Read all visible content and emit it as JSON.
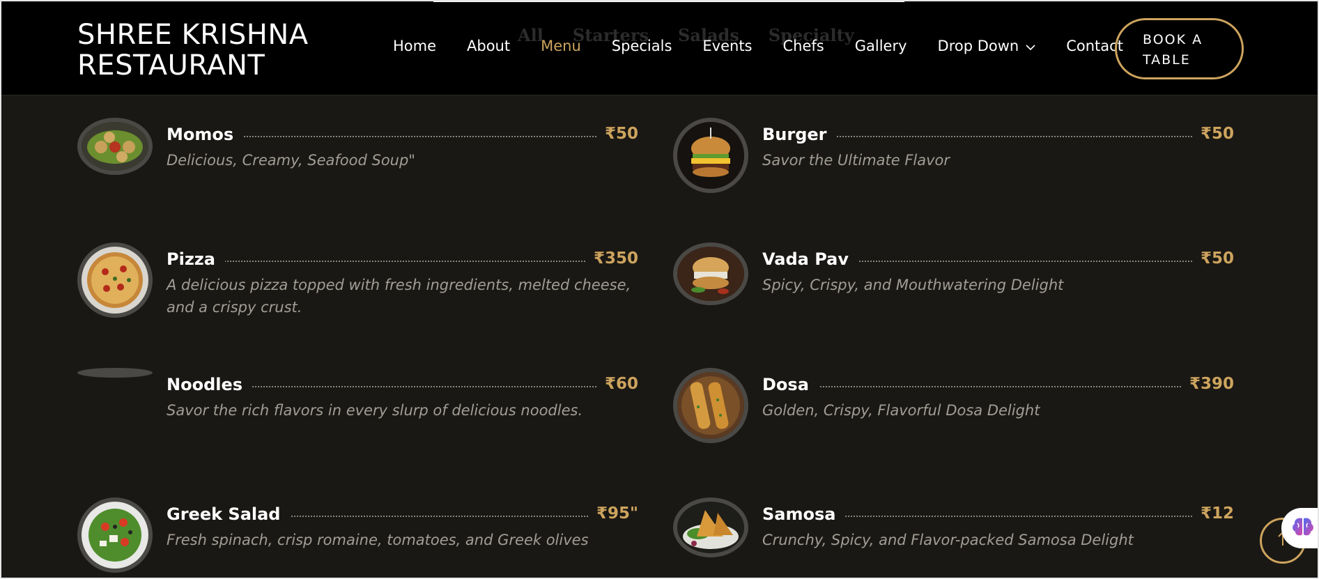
{
  "header": {
    "logo": "SHREE KRISHNA RESTAURANT",
    "logo_line1": "SHREE KRISHNA",
    "logo_line2": "RESTAURANT",
    "nav": [
      {
        "label": "Home"
      },
      {
        "label": "About"
      },
      {
        "label": "Menu",
        "active": true
      },
      {
        "label": "Specials"
      },
      {
        "label": "Events"
      },
      {
        "label": "Chefs"
      },
      {
        "label": "Gallery"
      },
      {
        "label": "Drop Down"
      },
      {
        "label": "Contact"
      }
    ],
    "book_button_line1": "BOOK A",
    "book_button_line2": "TABLE"
  },
  "menu_filters": [
    "All",
    "Starters",
    "Salads",
    "Specialty"
  ],
  "menu_items": [
    {
      "name": "Momos",
      "price": "₹50",
      "description": "Delicious, Creamy, Seafood Soup\""
    },
    {
      "name": "Burger",
      "price": "₹50",
      "description": "Savor the Ultimate Flavor"
    },
    {
      "name": "Pizza",
      "price": "₹350",
      "description": "A delicious pizza topped with fresh ingredients, melted cheese, and a crispy crust."
    },
    {
      "name": "Vada Pav",
      "price": "₹50",
      "description": "Spicy, Crispy, and Mouthwatering Delight"
    },
    {
      "name": "Noodles",
      "price": "₹60",
      "description": "Savor the rich flavors in every slurp of delicious noodles."
    },
    {
      "name": "Dosa",
      "price": "₹390",
      "description": "Golden, Crispy, Flavorful Dosa Delight"
    },
    {
      "name": "Greek Salad",
      "price": "₹95\"",
      "description": "Fresh spinach, crisp romaine, tomatoes, and Greek olives"
    },
    {
      "name": "Samosa",
      "price": "₹12",
      "description": "Crunchy, Spicy, and Flavor-packed Samosa Delight"
    }
  ],
  "colors": {
    "accent": "#cda45e",
    "background": "#1a1814",
    "header_bg": "#000000",
    "description": "#a19d96"
  },
  "icons": {
    "dropdown": "chevron-down-icon",
    "back_to_top": "arrow-up-icon",
    "assistant": "brain-icon"
  }
}
